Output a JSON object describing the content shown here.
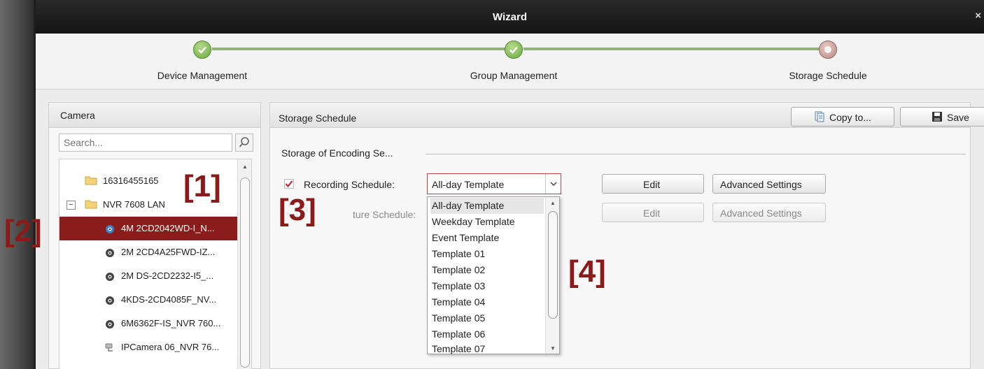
{
  "window": {
    "title": "Wizard",
    "close": "×"
  },
  "steps": [
    {
      "label": "Device Management",
      "state": "done"
    },
    {
      "label": "Group Management",
      "state": "done"
    },
    {
      "label": "Storage Schedule",
      "state": "current"
    }
  ],
  "camera_panel": {
    "title": "Camera",
    "search_placeholder": "Search...",
    "tree": [
      {
        "label": "16316455165",
        "type": "folder",
        "level": 0
      },
      {
        "label": "NVR 7608 LAN",
        "type": "folder",
        "level": 0,
        "expanded": true
      },
      {
        "label": "4M 2CD2042WD-I_N...",
        "type": "camera",
        "level": 1,
        "selected": true
      },
      {
        "label": "2M 2CD4A25FWD-IZ...",
        "type": "camera",
        "level": 1
      },
      {
        "label": "2M DS-2CD2232-I5_...",
        "type": "camera",
        "level": 1
      },
      {
        "label": "4KDS-2CD4085F_NV...",
        "type": "camera",
        "level": 1
      },
      {
        "label": "6M6362F-IS_NVR 760...",
        "type": "camera",
        "level": 1
      },
      {
        "label": "IPCamera 06_NVR 76...",
        "type": "ipcamera",
        "level": 1
      }
    ]
  },
  "storage_panel": {
    "title": "Storage Schedule",
    "copy_label": "Copy to...",
    "save_label": "Save",
    "section_title": "Storage of Encoding Se...",
    "recording": {
      "label": "Recording Schedule:",
      "checked": true,
      "template": "All-day Template",
      "edit_label": "Edit",
      "advanced_label": "Advanced Settings"
    },
    "capture": {
      "label": "ture Schedule:",
      "edit_label": "Edit",
      "advanced_label": "Advanced Settings"
    },
    "template_options": [
      "All-day Template",
      "Weekday Template",
      "Event Template",
      "Template 01",
      "Template 02",
      "Template 03",
      "Template 04",
      "Template 05",
      "Template 06",
      "Template 07"
    ]
  },
  "annotations": {
    "a1": "[1]",
    "a2": "[2]",
    "a3": "[3]",
    "a4": "[4]"
  },
  "colors": {
    "accent": "#8a1c1c",
    "step_done": "#6aa93e",
    "step_current": "#b98c86",
    "annotation": "#8b1a1a"
  }
}
